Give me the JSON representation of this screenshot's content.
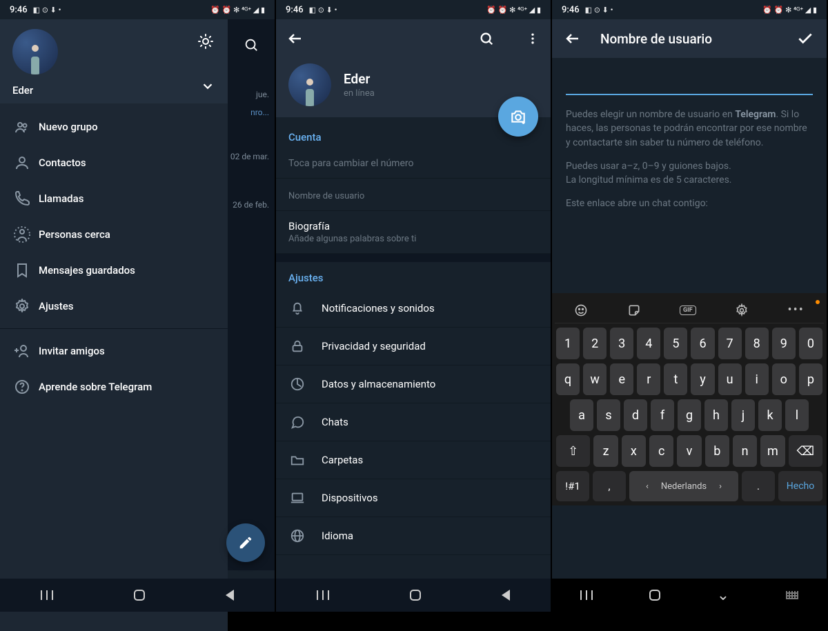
{
  "status": {
    "time": "9:46",
    "icons_left": "◧ ⊙ ⬇ •",
    "icons_right": "⏰ ⏰ ✻ ⁴ᴳ⁺ ◢ ▮"
  },
  "p1": {
    "user": "Eder",
    "drawer": [
      {
        "icon": "group",
        "label": "Nuevo grupo"
      },
      {
        "icon": "person",
        "label": "Contactos"
      },
      {
        "icon": "phone",
        "label": "Llamadas"
      },
      {
        "icon": "near",
        "label": "Personas cerca"
      },
      {
        "icon": "bookmark",
        "label": "Mensajes guardados"
      },
      {
        "icon": "gear",
        "label": "Ajustes"
      }
    ],
    "drawer2": [
      {
        "icon": "invite",
        "label": "Invitar amigos"
      },
      {
        "icon": "help",
        "label": "Aprende sobre Telegram"
      }
    ],
    "dates": [
      "jue.",
      "02 de mar.",
      "26 de feb."
    ],
    "snip": "nro..."
  },
  "p2": {
    "name": "Eder",
    "status": "en línea",
    "section_account": "Cuenta",
    "phone_placeholder": "Toca para cambiar el número",
    "username_label": "Nombre de usuario",
    "bio_label": "Biografía",
    "bio_sub": "Añade algunas palabras sobre ti",
    "section_settings": "Ajustes",
    "settings": [
      {
        "icon": "bell",
        "label": "Notificaciones y sonidos"
      },
      {
        "icon": "lock",
        "label": "Privacidad y seguridad"
      },
      {
        "icon": "data",
        "label": "Datos y almacenamiento"
      },
      {
        "icon": "chat",
        "label": "Chats"
      },
      {
        "icon": "folder",
        "label": "Carpetas"
      },
      {
        "icon": "device",
        "label": "Dispositivos"
      },
      {
        "icon": "globe",
        "label": "Idioma"
      }
    ]
  },
  "p3": {
    "title": "Nombre de usuario",
    "help1a": "Puedes elegir un nombre de usuario en ",
    "help1b": "Telegram",
    "help1c": ". Si lo haces, las personas te podrán encontrar por ese nombre y contactarte sin saber tu número de teléfono.",
    "help2": "Puedes usar a–z, 0–9 y guiones bajos.\nLa longitud mínima es de 5 caracteres.",
    "help3": "Este enlace abre un chat contigo:",
    "keyboard": {
      "nums": [
        "1",
        "2",
        "3",
        "4",
        "5",
        "6",
        "7",
        "8",
        "9",
        "0"
      ],
      "row1": [
        "q",
        "w",
        "e",
        "r",
        "t",
        "y",
        "u",
        "i",
        "o",
        "p"
      ],
      "row2": [
        "a",
        "s",
        "d",
        "f",
        "g",
        "h",
        "j",
        "k",
        "l"
      ],
      "row3": [
        "z",
        "x",
        "c",
        "v",
        "b",
        "n",
        "m"
      ],
      "shift": "⇧",
      "back": "⌫",
      "sym": "!#1",
      "comma": ",",
      "lang": "Nederlands",
      "period": ".",
      "done": "Hecho"
    }
  }
}
